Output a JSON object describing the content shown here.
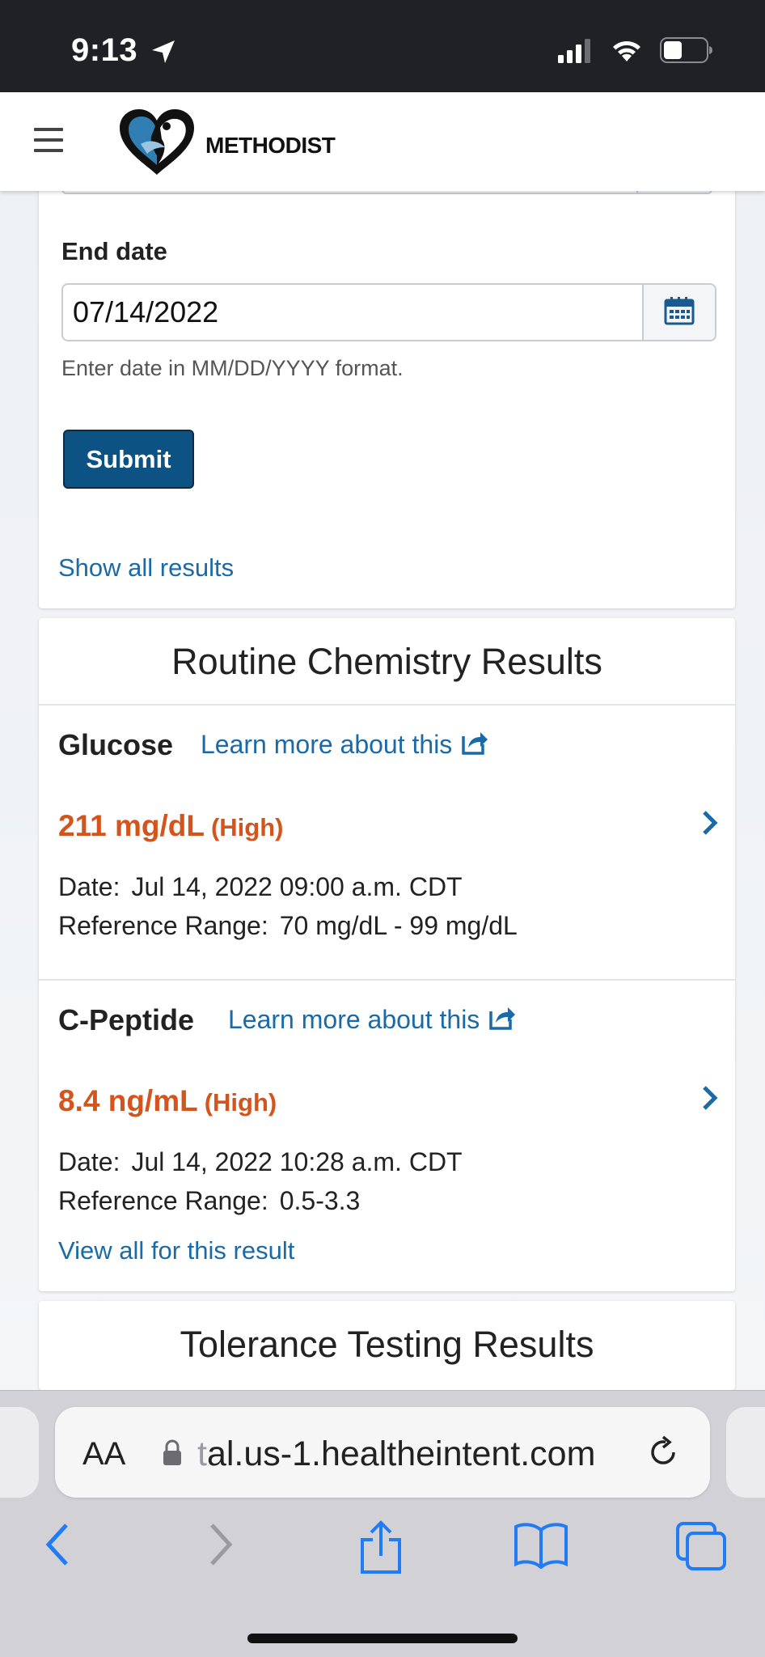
{
  "status": {
    "time": "9:13"
  },
  "brand": {
    "name": "METHODIST"
  },
  "form": {
    "end_date_label": "End date",
    "end_date_value": "07/14/2022",
    "date_hint": "Enter date in MM/DD/YYYY format.",
    "submit_label": "Submit",
    "show_all_label": "Show all results"
  },
  "routine": {
    "title": "Routine Chemistry Results",
    "results": [
      {
        "name": "Glucose",
        "learn_more": "Learn more about this",
        "value": "211 mg/dL",
        "flag": "(High)",
        "date_label": "Date:",
        "date": "Jul 14, 2022 09:00 a.m. CDT",
        "range_label": "Reference Range:",
        "range": "70 mg/dL - 99 mg/dL"
      },
      {
        "name": "C-Peptide",
        "learn_more": "Learn more about this",
        "value": "8.4 ng/mL",
        "flag": "(High)",
        "date_label": "Date:",
        "date": "Jul 14, 2022 10:28 a.m. CDT",
        "range_label": "Reference Range:",
        "range": "0.5-3.3"
      }
    ],
    "view_all_label": "View all for this result"
  },
  "tolerance": {
    "title": "Tolerance Testing Results"
  },
  "browser": {
    "aa_label": "AA",
    "url_faded": "t",
    "url": "al.us-1.healtheintent.com"
  },
  "colors": {
    "link": "#1a6aa8",
    "high_flag": "#d4541c",
    "primary_button": "#0c5283",
    "ios_blue": "#1f7cf5"
  }
}
